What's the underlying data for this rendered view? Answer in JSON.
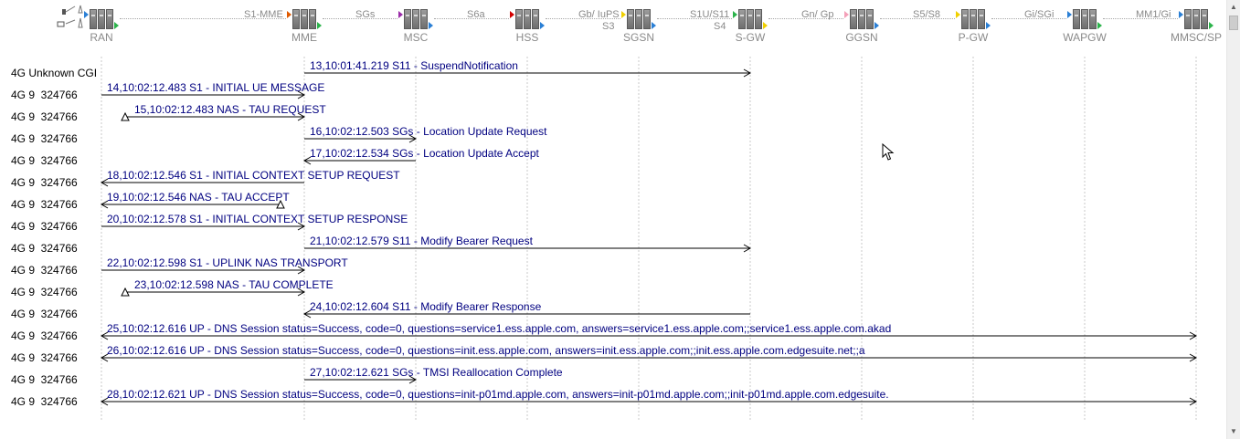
{
  "nodes": [
    {
      "name": "RAN",
      "iface": ""
    },
    {
      "name": "MME",
      "iface": "S1-MME"
    },
    {
      "name": "MSC",
      "iface": "SGs"
    },
    {
      "name": "HSS",
      "iface": "S6a"
    },
    {
      "name": "SGSN",
      "iface": "Gb/ IuPS",
      "iface2": "S3"
    },
    {
      "name": "S-GW",
      "iface": "S1U/S11",
      "iface2": "S4"
    },
    {
      "name": "GGSN",
      "iface": "Gn/ Gp"
    },
    {
      "name": "P-GW",
      "iface": "S5/S8"
    },
    {
      "name": "WAPGW",
      "iface": "Gi/SGi"
    },
    {
      "name": "MMSC/SP",
      "iface": "MM1/Gi"
    }
  ],
  "messages": [
    {
      "cell": "4G Unknown CGI",
      "text": "13,10:01:41.219 S11 - SuspendNotification",
      "from": 1,
      "to": 5,
      "dir": "right"
    },
    {
      "cell": "4G 9  324766",
      "text": "14,10:02:12.483 S1 - INITIAL UE MESSAGE",
      "from": 0,
      "to": 1,
      "dir": "right"
    },
    {
      "cell": "4G 9  324766",
      "text": "15,10:02:12.483 NAS - TAU REQUEST",
      "from": 0,
      "to": 1,
      "dir": "right",
      "nas": "left"
    },
    {
      "cell": "4G 9  324766",
      "text": "16,10:02:12.503 SGs - Location Update Request",
      "from": 1,
      "to": 2,
      "dir": "right"
    },
    {
      "cell": "4G 9  324766",
      "text": "17,10:02:12.534 SGs - Location Update Accept",
      "from": 1,
      "to": 2,
      "dir": "left"
    },
    {
      "cell": "4G 9  324766",
      "text": "18,10:02:12.546 S1 - INITIAL CONTEXT SETUP REQUEST",
      "from": 0,
      "to": 1,
      "dir": "left"
    },
    {
      "cell": "4G 9  324766",
      "text": "19,10:02:12.546 NAS - TAU ACCEPT",
      "from": 0,
      "to": 1,
      "dir": "left",
      "nas": "right"
    },
    {
      "cell": "4G 9  324766",
      "text": "20,10:02:12.578 S1 - INITIAL CONTEXT SETUP RESPONSE",
      "from": 0,
      "to": 1,
      "dir": "right"
    },
    {
      "cell": "4G 9  324766",
      "text": "21,10:02:12.579 S11 - Modify Bearer Request",
      "from": 1,
      "to": 5,
      "dir": "right"
    },
    {
      "cell": "4G 9  324766",
      "text": "22,10:02:12.598 S1 - UPLINK NAS TRANSPORT",
      "from": 0,
      "to": 1,
      "dir": "right"
    },
    {
      "cell": "4G 9  324766",
      "text": "23,10:02:12.598 NAS - TAU COMPLETE",
      "from": 0,
      "to": 1,
      "dir": "right",
      "nas": "left"
    },
    {
      "cell": "4G 9  324766",
      "text": "24,10:02:12.604 S11 - Modify Bearer Response",
      "from": 1,
      "to": 5,
      "dir": "left"
    },
    {
      "cell": "4G 9  324766",
      "text": "25,10:02:12.616 UP - DNS Session status=Success, code=0, questions=service1.ess.apple.com, answers=service1.ess.apple.com;;service1.ess.apple.com.akad",
      "from": 0,
      "to": 9,
      "dir": "both"
    },
    {
      "cell": "4G 9  324766",
      "text": "26,10:02:12.616 UP - DNS Session status=Success, code=0, questions=init.ess.apple.com, answers=init.ess.apple.com;;init.ess.apple.com.edgesuite.net;;a",
      "from": 0,
      "to": 9,
      "dir": "both"
    },
    {
      "cell": "4G 9  324766",
      "text": "27,10:02:12.621 SGs - TMSI Reallocation Complete",
      "from": 1,
      "to": 2,
      "dir": "right"
    },
    {
      "cell": "4G 9  324766",
      "text": "28,10:02:12.621 UP - DNS Session status=Success, code=0, questions=init-p01md.apple.com, answers=init-p01md.apple.com;;init-p01md.apple.com.edgesuite.",
      "from": 0,
      "to": 9,
      "dir": "both"
    }
  ],
  "scrollbar": {
    "up_icon": "scroll-up-arrow-icon",
    "down_icon": "scroll-down-arrow-icon"
  },
  "colors": {
    "message_text": "#000080",
    "lane_line": "#c8c8c8",
    "arrow": "#000000",
    "node_label": "#8a8a8a"
  }
}
